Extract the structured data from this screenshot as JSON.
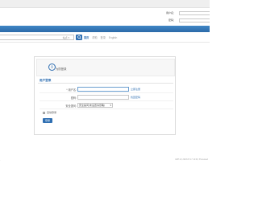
{
  "header": {
    "username_label": "用户名：",
    "password_label": "密码："
  },
  "toolbar": {
    "search_text": "站点 ▾",
    "links": [
      "首页",
      "帮助",
      "登录",
      "English"
    ]
  },
  "banner": {
    "text": "为防登录"
  },
  "form": {
    "section_title": "用户登录",
    "username_label": "* 用户名:",
    "username_link": "立即注册",
    "password_label": "密码:",
    "password_link": "找回密码",
    "question_label": "安全提问:",
    "question_value": "安全提问(未设置请忽略)",
    "remember_label": "自动登录",
    "submit_label": "登录"
  },
  "footer": {
    "left": "·",
    "right": "GMT+8, 2023-07-17 12:00, Processed"
  }
}
